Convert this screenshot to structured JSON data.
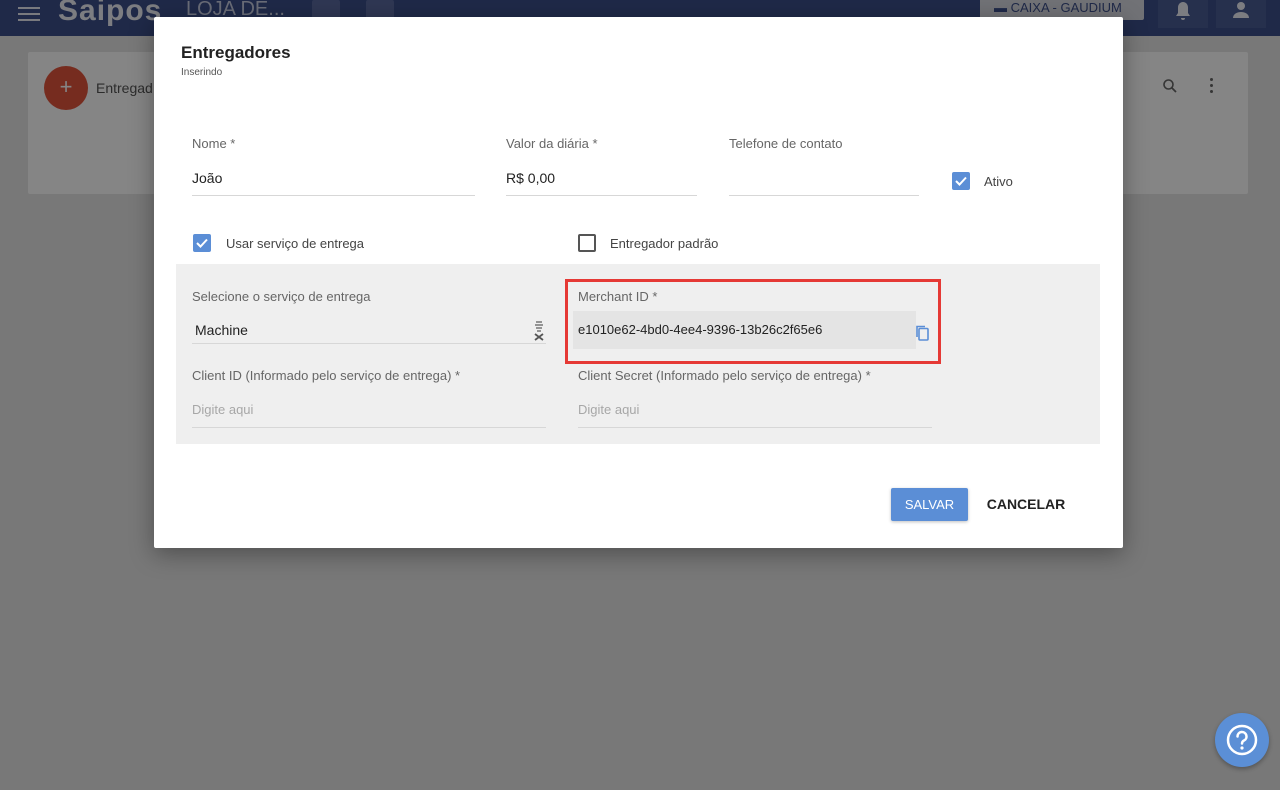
{
  "app": {
    "logo": "Saipos",
    "store_name": "LOJA DE...",
    "cash_label": "CAIXA - GAUDIUM"
  },
  "page": {
    "card_title": "Entregad"
  },
  "modal": {
    "title": "Entregadores",
    "subtitle": "Inserindo",
    "fields": {
      "name": {
        "label": "Nome *",
        "value": "João"
      },
      "daily_rate": {
        "label": "Valor da diária *",
        "value": "R$ 0,00"
      },
      "phone": {
        "label": "Telefone de contato",
        "value": ""
      },
      "active": {
        "label": "Ativo",
        "checked": true
      },
      "use_service": {
        "label": "Usar serviço de entrega",
        "checked": true
      },
      "default_courier": {
        "label": "Entregador padrão",
        "checked": false
      },
      "service_select": {
        "label": "Selecione o serviço de entrega",
        "value": "Machine"
      },
      "merchant_id": {
        "label": "Merchant ID *",
        "value": "e1010e62-4bd0-4ee4-9396-13b26c2f65e6"
      },
      "client_id": {
        "label": "Client ID (Informado pelo serviço de entrega) *",
        "placeholder": "Digite aqui"
      },
      "client_secret": {
        "label": "Client Secret (Informado pelo serviço de entrega) *",
        "placeholder": "Digite aqui"
      }
    },
    "buttons": {
      "save": "SALVAR",
      "cancel": "CANCELAR"
    }
  },
  "colors": {
    "primary": "#5b8ed6",
    "topbar": "#3d4f8a",
    "highlight": "#e53935",
    "fab": "#e2553d"
  },
  "icons": [
    "menu-icon",
    "bell-icon",
    "user-icon",
    "plus-icon",
    "search-icon",
    "more-vert-icon",
    "check-icon",
    "clear-icon",
    "copy-icon",
    "help-icon"
  ]
}
